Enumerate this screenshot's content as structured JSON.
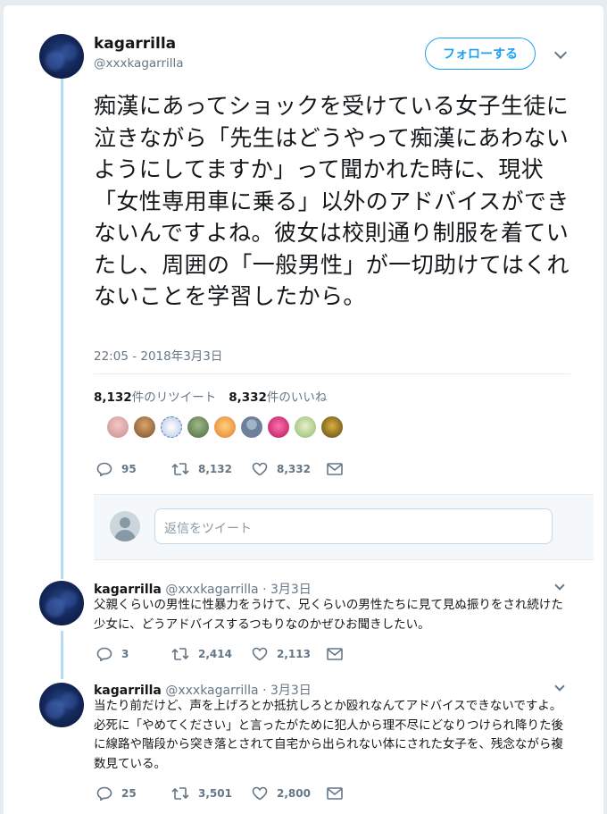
{
  "colors": {
    "accent": "#1da1f2",
    "muted": "#657786",
    "thread": "#b3dcf7"
  },
  "tweet": {
    "display_name": "kagarrilla",
    "handle": "@xxxkagarrilla",
    "follow_label": "フォローする",
    "text": "痴漢にあってショックを受けている女子生徒に泣きながら「先生はどうやって痴漢にあわないようにしてますか」って聞かれた時に、現状「女性専用車に乗る」以外のアドバイスができないんですよね。彼女は校則通り制服を着ていたし、周囲の「一般男性」が一切助けてはくれないことを学習したから。",
    "timestamp": "22:05 - 2018年3月3日",
    "retweets_count": "8,132",
    "retweets_label": "件のリツイート",
    "likes_count": "8,332",
    "likes_label": "件のいいね",
    "replies": "95",
    "retweets": "8,132",
    "likes": "8,332"
  },
  "reply_box": {
    "placeholder": "返信をツイート"
  },
  "replies": [
    {
      "display_name": "kagarrilla",
      "handle": "@xxxkagarrilla",
      "date": "· 3月3日",
      "text": "父親くらいの男性に性暴力をうけて、兄くらいの男性たちに見て見ぬ振りをされ続けた少女に、どうアドバイスするつもりなのかぜひお聞きしたい。",
      "replies": "3",
      "retweets": "2,414",
      "likes": "2,113"
    },
    {
      "display_name": "kagarrilla",
      "handle": "@xxxkagarrilla",
      "date": "· 3月3日",
      "text": "当たり前だけど、声を上げろとか抵抗しろとか殴れなんてアドバイスできないですよ。必死に「やめてください」と言ったがために犯人から理不尽にどなりつけられ降りた後に線路や階段から突き落とされて自宅から出られない体にされた女子を、残念ながら複数見ている。",
      "replies": "25",
      "retweets": "3,501",
      "likes": "2,800"
    }
  ],
  "icons": {
    "reply": "reply-icon",
    "retweet": "retweet-icon",
    "like": "heart-icon",
    "dm": "envelope-icon",
    "more": "chevron-down-icon"
  }
}
